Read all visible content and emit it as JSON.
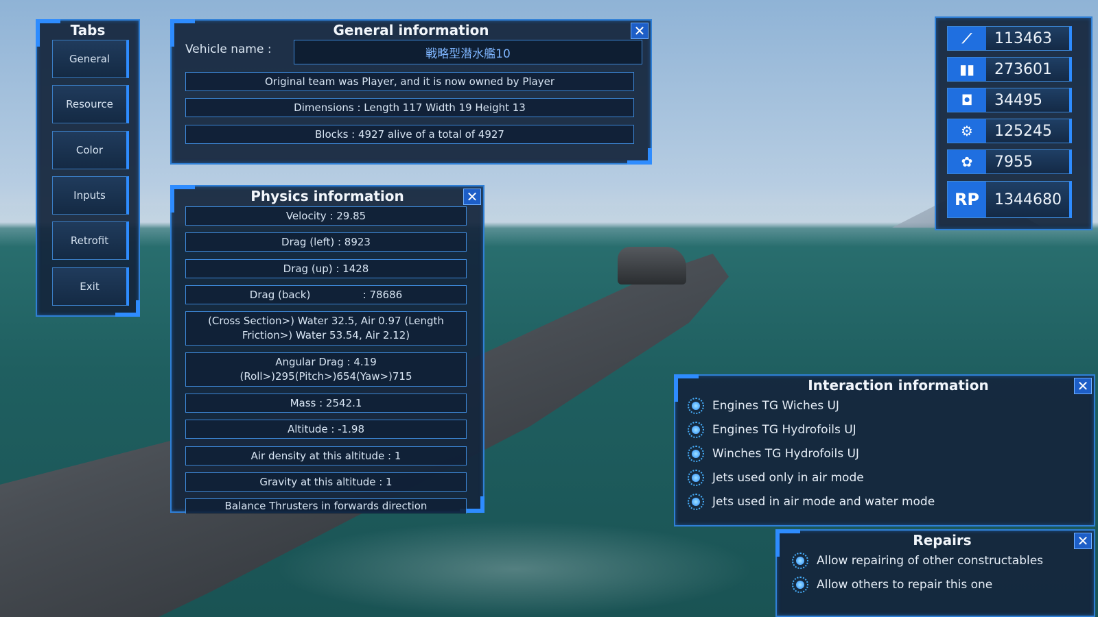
{
  "tabs": {
    "title": "Tabs",
    "items": [
      "General",
      "Resource",
      "Color",
      "Inputs",
      "Retrofit",
      "Exit"
    ]
  },
  "general": {
    "title": "General information",
    "close": "✕",
    "vehicle_label": "Vehicle name :",
    "vehicle_name": "戦略型潜水艦10",
    "rows": [
      "Original team was Player, and it is now owned by Player",
      "Dimensions : Length 117 Width 19 Height 13",
      "Blocks : 4927 alive of a total of 4927"
    ]
  },
  "physics": {
    "title": "Physics information",
    "close": "✕",
    "rows": [
      "Velocity : 29.85",
      "Drag (left) : 8923",
      "Drag (up) : 1428",
      "Drag (back)                : 78686",
      "(Cross Section>) Water 32.5, Air 0.97        (Length Friction>) Water 53.54, Air 2.12)",
      "Angular Drag : 4.19 (Roll>)295(Pitch>)654(Yaw>)715",
      "Mass : 2542.1",
      "Altitude : -1.98",
      "Air density at this altitude : 1",
      "Gravity at this altitude : 1",
      "Balance Thrusters in forwards direction"
    ]
  },
  "resources": {
    "items": [
      {
        "icon": "material-icon",
        "value": "113463"
      },
      {
        "icon": "fuel-icon",
        "value": "273601"
      },
      {
        "icon": "ammo-icon",
        "value": "34495"
      },
      {
        "icon": "metal-icon",
        "value": "125245"
      },
      {
        "icon": "natural-icon",
        "value": "7955"
      },
      {
        "icon": "rp-icon",
        "label": "RP",
        "value": "1344680"
      }
    ]
  },
  "interaction": {
    "title": "Interaction information",
    "close": "✕",
    "items": [
      "Engines TG Wiches UJ",
      "Engines TG Hydrofoils UJ",
      "Winches TG Hydrofoils UJ",
      "Jets used only in air mode",
      "Jets used in air mode and water mode"
    ]
  },
  "repairs": {
    "title": "Repairs",
    "close": "✕",
    "items": [
      "Allow repairing of other constructables",
      "Allow others to repair this one"
    ]
  },
  "colors": {
    "accent": "#2e8cff",
    "panel_bg": "#14263c",
    "button_blue": "#1d5ec7"
  }
}
